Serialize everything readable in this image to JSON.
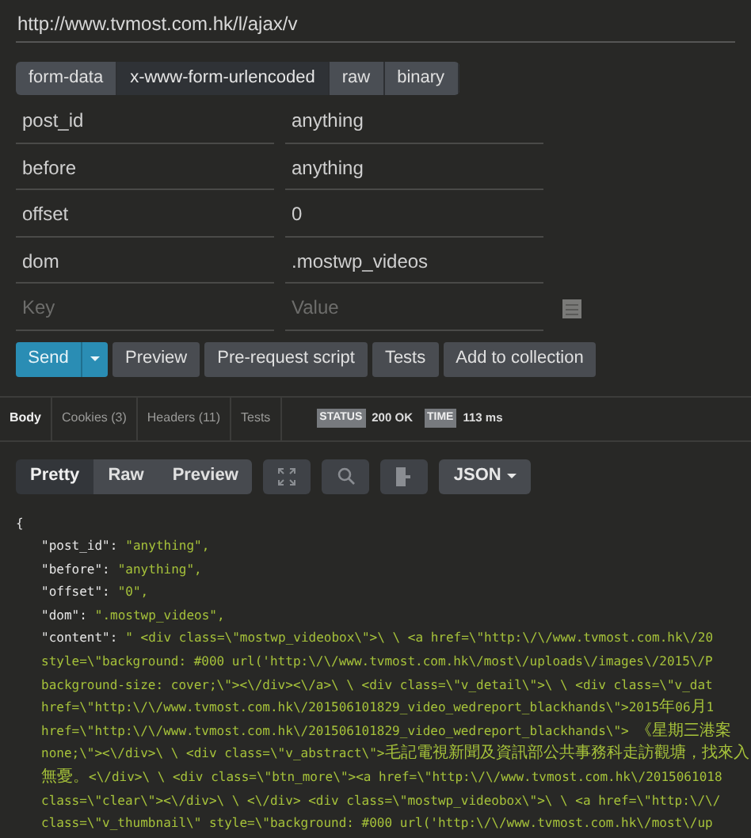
{
  "url": "http://www.tvmost.com.hk/l/ajax/v",
  "body_tabs": [
    {
      "label": "form-data",
      "selected": false
    },
    {
      "label": "x-www-form-urlencoded",
      "selected": true
    },
    {
      "label": "raw",
      "selected": false
    },
    {
      "label": "binary",
      "selected": false
    }
  ],
  "params": [
    {
      "key": "post_id",
      "value": "anything"
    },
    {
      "key": "before",
      "value": "anything"
    },
    {
      "key": "offset",
      "value": "0"
    },
    {
      "key": "dom",
      "value": ".mostwp_videos"
    }
  ],
  "new_param": {
    "key_placeholder": "Key",
    "value_placeholder": "Value"
  },
  "send_button": "Send",
  "actions": [
    "Preview",
    "Pre-request script",
    "Tests",
    "Add to collection"
  ],
  "response_tabs": [
    {
      "label": "Body",
      "selected": true
    },
    {
      "label": "Cookies (3)",
      "selected": false
    },
    {
      "label": "Headers (11)",
      "selected": false
    },
    {
      "label": "Tests",
      "selected": false
    }
  ],
  "status": {
    "label": "STATUS",
    "value": "200 OK"
  },
  "time": {
    "label": "TIME",
    "value": "113 ms"
  },
  "view_modes": [
    {
      "label": "Pretty",
      "selected": true
    },
    {
      "label": "Raw",
      "selected": false
    },
    {
      "label": "Preview",
      "selected": false
    }
  ],
  "format": "JSON",
  "code_lines": [
    {
      "kind": "punct",
      "text": "{"
    },
    {
      "kind": "pair",
      "key": "\"post_id\":",
      "value": "\"anything\","
    },
    {
      "kind": "pair",
      "key": "\"before\":",
      "value": "\"anything\","
    },
    {
      "kind": "pair",
      "key": "\"offset\":",
      "value": "\"0\","
    },
    {
      "kind": "pair",
      "key": "\"dom\":",
      "value": "\".mostwp_videos\","
    },
    {
      "kind": "pair",
      "key": "\"content\":",
      "value": "\" <div class=\\\"mostwp_videobox\\\">\\ \\ <a href=\\\"http:\\/\\/www.tvmost.com.hk\\/20"
    },
    {
      "kind": "cont",
      "text": "style=\\\"background: #000 url('http:\\/\\/www.tvmost.com.hk\\/most\\/uploads\\/images\\/2015\\/P"
    },
    {
      "kind": "cont",
      "text": "background-size: cover;\\\"><\\/div><\\/a>\\ \\ <div class=\\\"v_detail\\\">\\ \\ <div class=\\\"v_dat"
    },
    {
      "kind": "cont",
      "text": "href=\\\"http:\\/\\/www.tvmost.com.hk\\/201506101829_video_wedreport_blackhands\\\">2015年06月1"
    },
    {
      "kind": "cont",
      "text": "href=\\\"http:\\/\\/www.tvmost.com.hk\\/201506101829_video_wedreport_blackhands\\\"> 《星期三港案"
    },
    {
      "kind": "cont",
      "text": "none;\\\"><\\/div>\\ \\ <div class=\\\"v_abstract\\\">毛記電視新聞及資訊部公共事務科走訪觀塘，找來入"
    },
    {
      "kind": "cont",
      "text": "無憂。<\\/div>\\ \\ <div class=\\\"btn_more\\\"><a href=\\\"http:\\/\\/www.tvmost.com.hk\\/2015061018"
    },
    {
      "kind": "cont",
      "text": "class=\\\"clear\\\"><\\/div>\\ \\ <\\/div> <div class=\\\"mostwp_videobox\\\">\\ \\ <a href=\\\"http:\\/\\/"
    },
    {
      "kind": "cont",
      "text": "class=\\\"v_thumbnail\\\" style=\\\"background: #000 url('http:\\/\\/www.tvmost.com.hk\\/most\\/up"
    }
  ]
}
